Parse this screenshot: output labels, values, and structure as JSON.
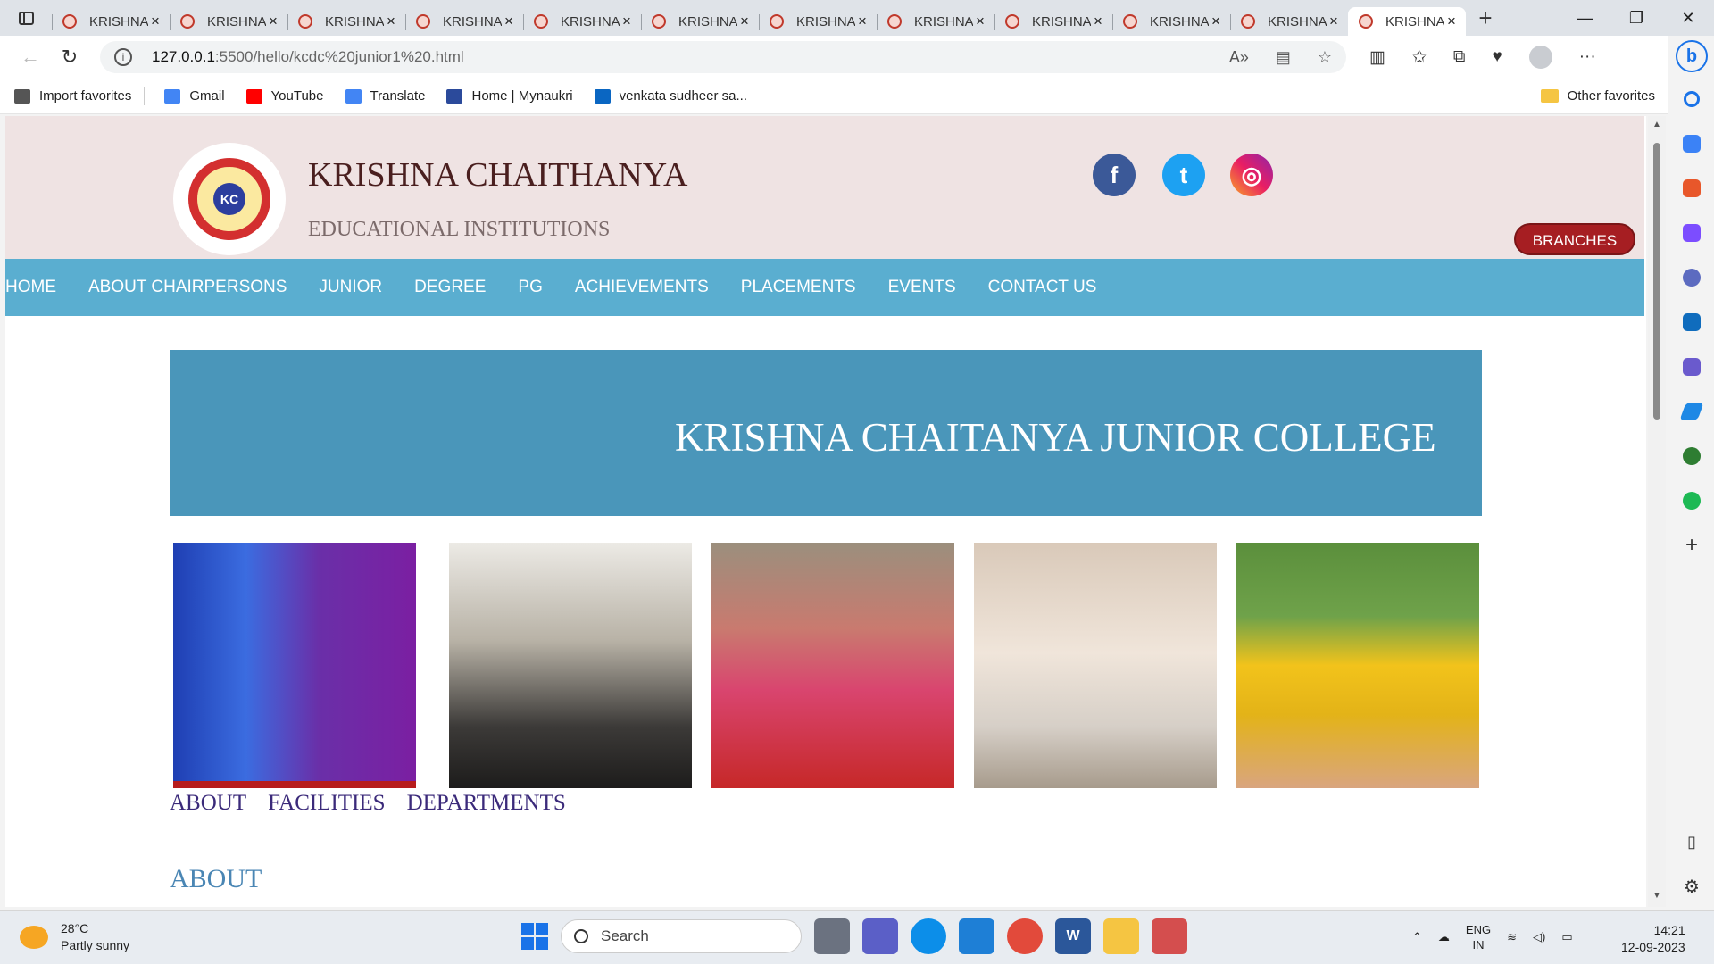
{
  "browser": {
    "tabs": [
      {
        "label": "KRISHNA",
        "active": false
      },
      {
        "label": "KRISHNA",
        "active": false
      },
      {
        "label": "KRISHNA",
        "active": false
      },
      {
        "label": "KRISHNA",
        "active": false
      },
      {
        "label": "KRISHNA",
        "active": false
      },
      {
        "label": "KRISHNA",
        "active": false
      },
      {
        "label": "KRISHNA",
        "active": false
      },
      {
        "label": "KRISHNA",
        "active": false
      },
      {
        "label": "KRISHNA",
        "active": false
      },
      {
        "label": "KRISHNA",
        "active": false
      },
      {
        "label": "KRISHNA",
        "active": false
      },
      {
        "label": "KRISHNA",
        "active": true
      }
    ],
    "address": {
      "host": "127.0.0.1",
      "path": ":5500/hello/kcdc%20junior1%20.html"
    },
    "bookmarks": [
      {
        "label": "Import favorites",
        "icon": "import-icon",
        "color": "#555555"
      },
      {
        "label": "Gmail",
        "icon": "google-icon",
        "color": "#4285f4"
      },
      {
        "label": "YouTube",
        "icon": "youtube-icon",
        "color": "#ff0000"
      },
      {
        "label": "Translate",
        "icon": "translate-icon",
        "color": "#4285f4"
      },
      {
        "label": "Home | Mynaukri",
        "icon": "naukri-icon",
        "color": "#2b4a9b"
      },
      {
        "label": "venkata sudheer sa...",
        "icon": "linkedin-icon",
        "color": "#0a66c2"
      }
    ],
    "other_favorites": "Other favorites"
  },
  "site": {
    "brand_name": "KRISHNA CHAITHANYA",
    "tagline": "EDUCATIONAL INSTITUTIONS",
    "logo_text": "KC",
    "social": [
      {
        "name": "facebook",
        "glyph": "f"
      },
      {
        "name": "twitter",
        "glyph": "t"
      },
      {
        "name": "instagram",
        "glyph": "◎"
      }
    ],
    "branches_label": "BRANCHES",
    "nav": [
      "HOME",
      "ABOUT CHAIRPERSONS",
      "JUNIOR",
      "DEGREE",
      "PG",
      "ACHIEVEMENTS",
      "PLACEMENTS",
      "EVENTS",
      "CONTACT US"
    ],
    "banner_title": "KRISHNA CHAITANYA JUNIOR COLLEGE",
    "gallery": [
      {
        "name": "college-building-photo"
      },
      {
        "name": "classroom-students-photo"
      },
      {
        "name": "auditorium-students-photo"
      },
      {
        "name": "laboratory-photo"
      },
      {
        "name": "college-buses-photo"
      }
    ],
    "sublinks": [
      "ABOUT",
      "FACILITIES",
      "DEPARTMENTS"
    ],
    "section_heading": "ABOUT"
  },
  "taskbar": {
    "weather_temp": "28°C",
    "weather_desc": "Partly sunny",
    "search_placeholder": "Search",
    "lang_line1": "ENG",
    "lang_line2": "IN",
    "time": "14:21",
    "date": "12-09-2023"
  },
  "colors": {
    "nav_bg": "#5aaed0",
    "banner_bg": "#4a96ba",
    "header_bg": "#efe3e3",
    "branches_bg": "#a61e22"
  }
}
